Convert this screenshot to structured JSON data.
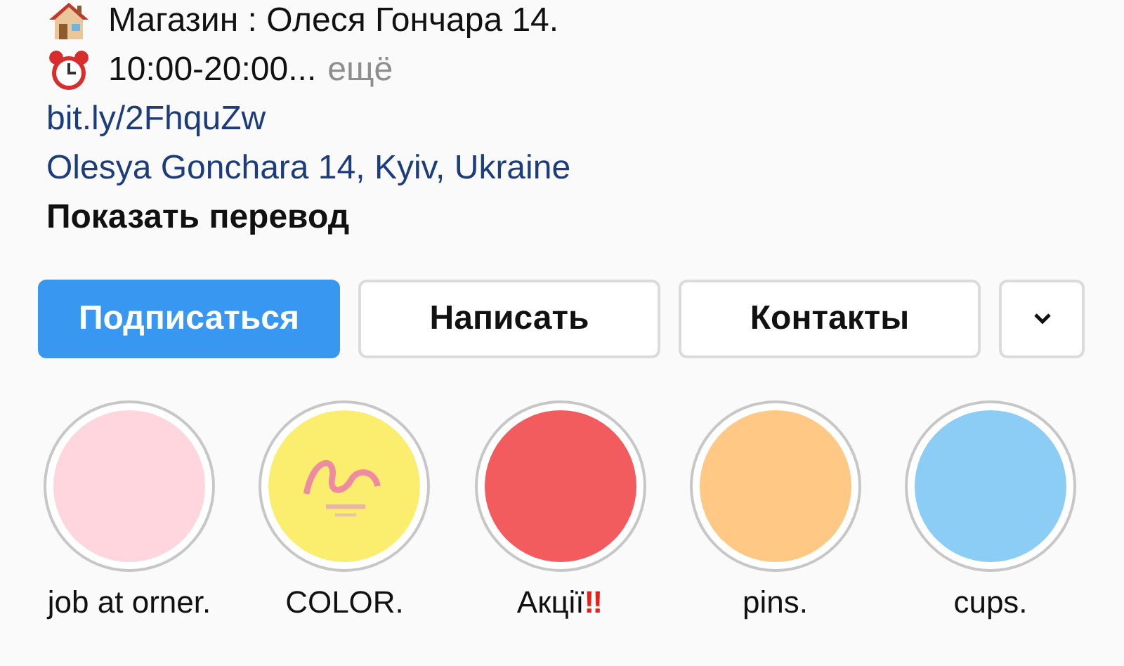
{
  "bio": {
    "address_line": "Магазин : Олеся Гончара 14.",
    "hours_line": "10:00-20:00...",
    "more_link": "ещё",
    "url": "bit.ly/2FhquZw",
    "location": "Olesya Gonchara 14, Kyiv, Ukraine",
    "translate_link": "Показать перевод"
  },
  "buttons": [
    {
      "label": "Подписаться",
      "primary": true
    },
    {
      "label": "Написать",
      "primary": false
    },
    {
      "label": "Контакты",
      "primary": false
    }
  ],
  "highlights": [
    {
      "title": "job at orner.",
      "kind": "color",
      "color": "#ffd6de"
    },
    {
      "title": "COLOR.",
      "kind": "picture"
    },
    {
      "title": "Акції",
      "emoji": "‼",
      "kind": "color",
      "color": "#f25c5f"
    },
    {
      "title": "pins.",
      "kind": "color",
      "color": "#ffc985"
    },
    {
      "title": "cups.",
      "kind": "color",
      "color": "#8ccdf5"
    }
  ]
}
